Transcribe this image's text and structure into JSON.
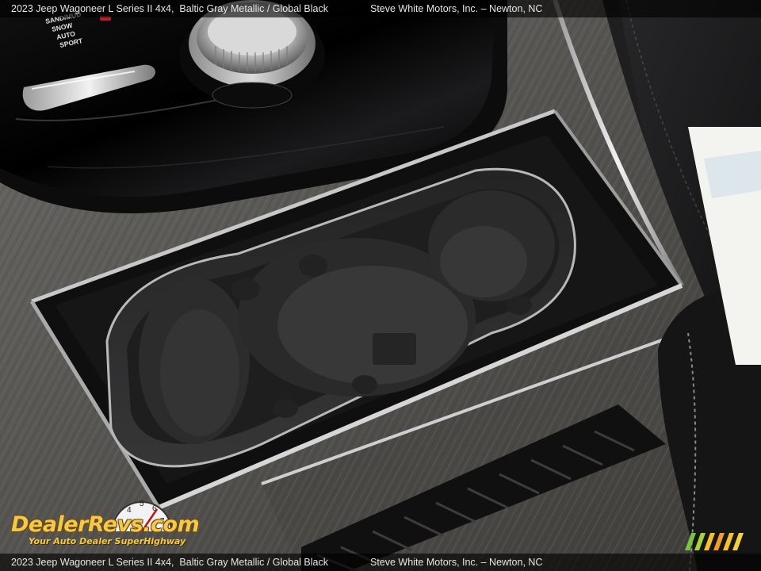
{
  "caption": {
    "vehicle": "2023 Jeep Wagoneer L Series II 4x4,",
    "color": "Baltic Gray Metallic / Global Black",
    "dealer": "Steve White Motors, Inc. – Newton, NC"
  },
  "console": {
    "drive_modes": [
      "SAND/MUD",
      "SNOW",
      "AUTO",
      "SPORT"
    ]
  },
  "watermark": {
    "brand": "DealerRevs.com",
    "tagline": "Your Auto Dealer SuperHighway",
    "gauge_digits": [
      "3",
      "4",
      "5",
      "6",
      "7"
    ]
  },
  "colors": {
    "wood_trim": "#5c5a57",
    "piano_black": "#050505",
    "cupholder": "#2a2a2b",
    "logo_gold": "#f4c84a"
  }
}
